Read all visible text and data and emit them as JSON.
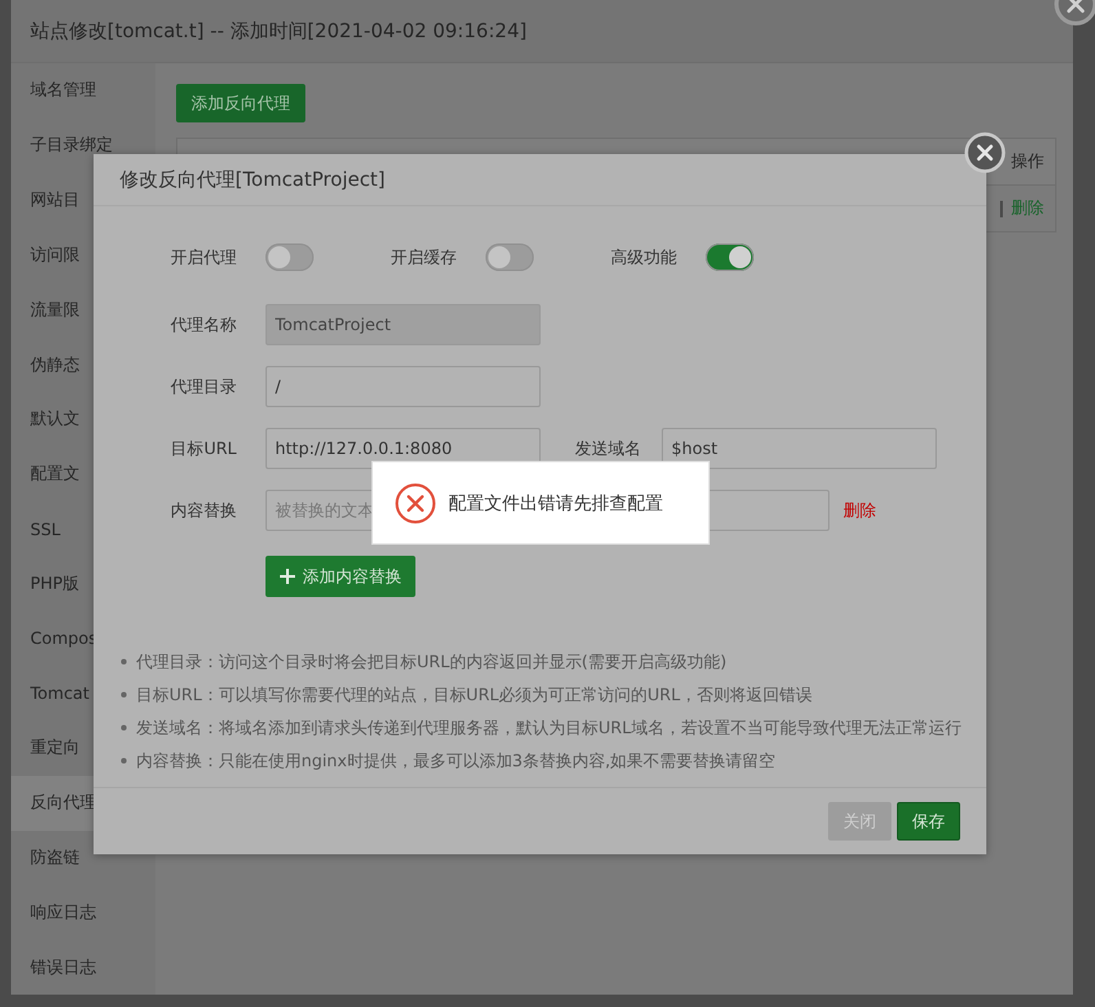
{
  "window": {
    "title": "站点修改[tomcat.t] -- 添加时间[2021-04-02 09:16:24]"
  },
  "sidebar": {
    "items": [
      {
        "label": "域名管理",
        "selected": false
      },
      {
        "label": "子目录绑定",
        "selected": false
      },
      {
        "label": "网站目",
        "selected": false
      },
      {
        "label": "访问限",
        "selected": false
      },
      {
        "label": "流量限",
        "selected": false
      },
      {
        "label": "伪静态",
        "selected": false
      },
      {
        "label": "默认文",
        "selected": false
      },
      {
        "label": "配置文",
        "selected": false
      },
      {
        "label": "SSL",
        "selected": false
      },
      {
        "label": "PHP版",
        "selected": false
      },
      {
        "label": "Compos",
        "selected": false
      },
      {
        "label": "Tomcat",
        "selected": false
      },
      {
        "label": "重定向",
        "selected": false
      },
      {
        "label": "反向代理",
        "selected": true
      },
      {
        "label": "防盗链",
        "selected": false
      },
      {
        "label": "响应日志",
        "selected": false
      },
      {
        "label": "错误日志",
        "selected": false
      }
    ]
  },
  "content": {
    "add_button": "添加反向代理",
    "table": {
      "columns": [
        "操作"
      ],
      "rows": [
        {
          "actions": [
            "删除"
          ]
        }
      ]
    }
  },
  "dialog": {
    "title": "修改反向代理[TomcatProject]",
    "switches": [
      {
        "label": "开启代理",
        "on": false
      },
      {
        "label": "开启缓存",
        "on": false
      },
      {
        "label": "高级功能",
        "on": true
      }
    ],
    "rows": [
      {
        "fields": [
          {
            "label": "代理名称",
            "value": "TomcatProject",
            "disabled": true
          }
        ]
      },
      {
        "fields": [
          {
            "label": "代理目录",
            "value": "/",
            "disabled": false
          }
        ]
      },
      {
        "fields": [
          {
            "label": "目标URL",
            "value": "http://127.0.0.1:8080",
            "disabled": false
          },
          {
            "label": "发送域名",
            "value": "$host",
            "disabled": false
          }
        ]
      }
    ],
    "replace": {
      "label": "内容替换",
      "placeholder": "被替换的文本",
      "delete": "删除",
      "add_button": "添加内容替换"
    },
    "notes": [
      "代理目录：访问这个目录时将会把目标URL的内容返回并显示(需要开启高级功能)",
      "目标URL：可以填写你需要代理的站点，目标URL必须为可正常访问的URL，否则将返回错误",
      "发送域名：将域名添加到请求头传递到代理服务器，默认为目标URL域名，若设置不当可能导致代理无法正常运行",
      "内容替换：只能在使用nginx时提供，最多可以添加3条替换内容,如果不需要替换请留空"
    ],
    "buttons": [
      {
        "label": "关闭",
        "kind": "secondary"
      },
      {
        "label": "保存",
        "kind": "primary"
      }
    ]
  },
  "toast": {
    "message": "配置文件出错请先排查配置",
    "kind": "error"
  }
}
